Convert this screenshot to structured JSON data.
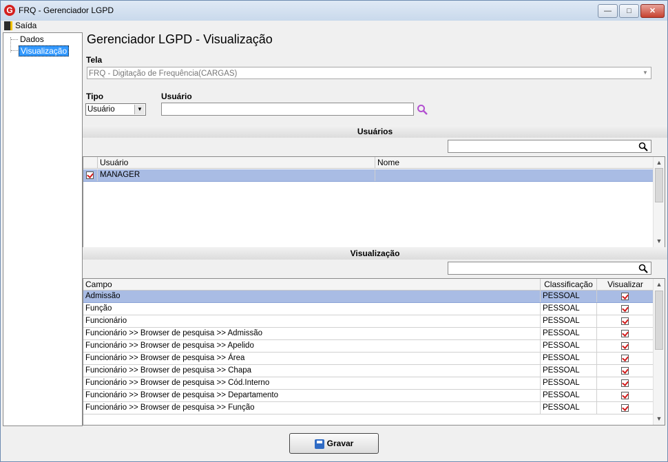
{
  "window": {
    "title": "FRQ - Gerenciador LGPD",
    "app_icon": "G"
  },
  "menu": {
    "exit_label": "Saída"
  },
  "tree": {
    "items": [
      {
        "label": "Dados"
      },
      {
        "label": "Visualização",
        "selected": true
      }
    ]
  },
  "page": {
    "title": "Gerenciador LGPD - Visualização"
  },
  "tela": {
    "label": "Tela",
    "value": "FRQ - Digitação de Frequência(CARGAS)"
  },
  "tipo": {
    "label": "Tipo",
    "value": "Usuário"
  },
  "usuario": {
    "label": "Usuário",
    "value": ""
  },
  "usuarios_section": {
    "title": "Usuários",
    "columns": [
      "Usuário",
      "Nome"
    ],
    "rows": [
      {
        "checked": true,
        "usuario": "MANAGER",
        "nome": ""
      }
    ]
  },
  "visualizacao_section": {
    "title": "Visualização",
    "columns": [
      "Campo",
      "Classificação",
      "Visualizar"
    ],
    "rows": [
      {
        "campo": "Admissão",
        "classificacao": "PESSOAL",
        "visualizar": true
      },
      {
        "campo": "Função",
        "classificacao": "PESSOAL",
        "visualizar": true
      },
      {
        "campo": "Funcionário",
        "classificacao": "PESSOAL",
        "visualizar": true
      },
      {
        "campo": "Funcionário >> Browser de pesquisa >> Admissão",
        "classificacao": "PESSOAL",
        "visualizar": true
      },
      {
        "campo": "Funcionário >> Browser de pesquisa >> Apelido",
        "classificacao": "PESSOAL",
        "visualizar": true
      },
      {
        "campo": "Funcionário >> Browser de pesquisa >> Área",
        "classificacao": "PESSOAL",
        "visualizar": true
      },
      {
        "campo": "Funcionário >> Browser de pesquisa >> Chapa",
        "classificacao": "PESSOAL",
        "visualizar": true
      },
      {
        "campo": "Funcionário >> Browser de pesquisa >> Cód.Interno",
        "classificacao": "PESSOAL",
        "visualizar": true
      },
      {
        "campo": "Funcionário >> Browser de pesquisa >> Departamento",
        "classificacao": "PESSOAL",
        "visualizar": true
      },
      {
        "campo": "Funcionário >> Browser de pesquisa >> Função",
        "classificacao": "PESSOAL",
        "visualizar": true
      }
    ]
  },
  "buttons": {
    "save_label": "Gravar"
  },
  "colors": {
    "selection": "#a9bce4",
    "tree_selection": "#3399ff",
    "check": "#d21b1b"
  }
}
